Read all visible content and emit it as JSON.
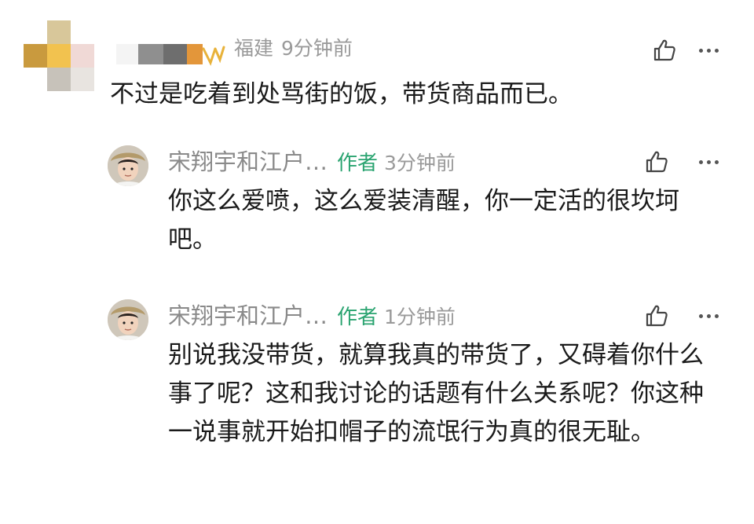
{
  "top_comment": {
    "location": "福建",
    "time": "9分钟前",
    "text": "不过是吃着到处骂街的饭，带货商品而已。",
    "like_icon": "thumbs-up-icon",
    "more_icon": "more-dots-icon"
  },
  "replies": [
    {
      "name": "宋翔宇和江户…",
      "tag": "作者",
      "time": "3分钟前",
      "text": "你这么爱喷，这么爱装清醒，你一定活的很坎坷吧。",
      "like_icon": "thumbs-up-icon",
      "more_icon": "more-dots-icon"
    },
    {
      "name": "宋翔宇和江户…",
      "tag": "作者",
      "time": "1分钟前",
      "text": "别说我没带货，就算我真的带货了，又碍着你什么事了呢？这和我讨论的话题有什么关系呢？你这种一说事就开始扣帽子的流氓行为真的很无耻。",
      "like_icon": "thumbs-up-icon",
      "more_icon": "more-dots-icon"
    }
  ],
  "colors": {
    "author_tag": "#2ba471",
    "meta_text": "#9a9a9a",
    "body_text": "#1a1a1a"
  }
}
